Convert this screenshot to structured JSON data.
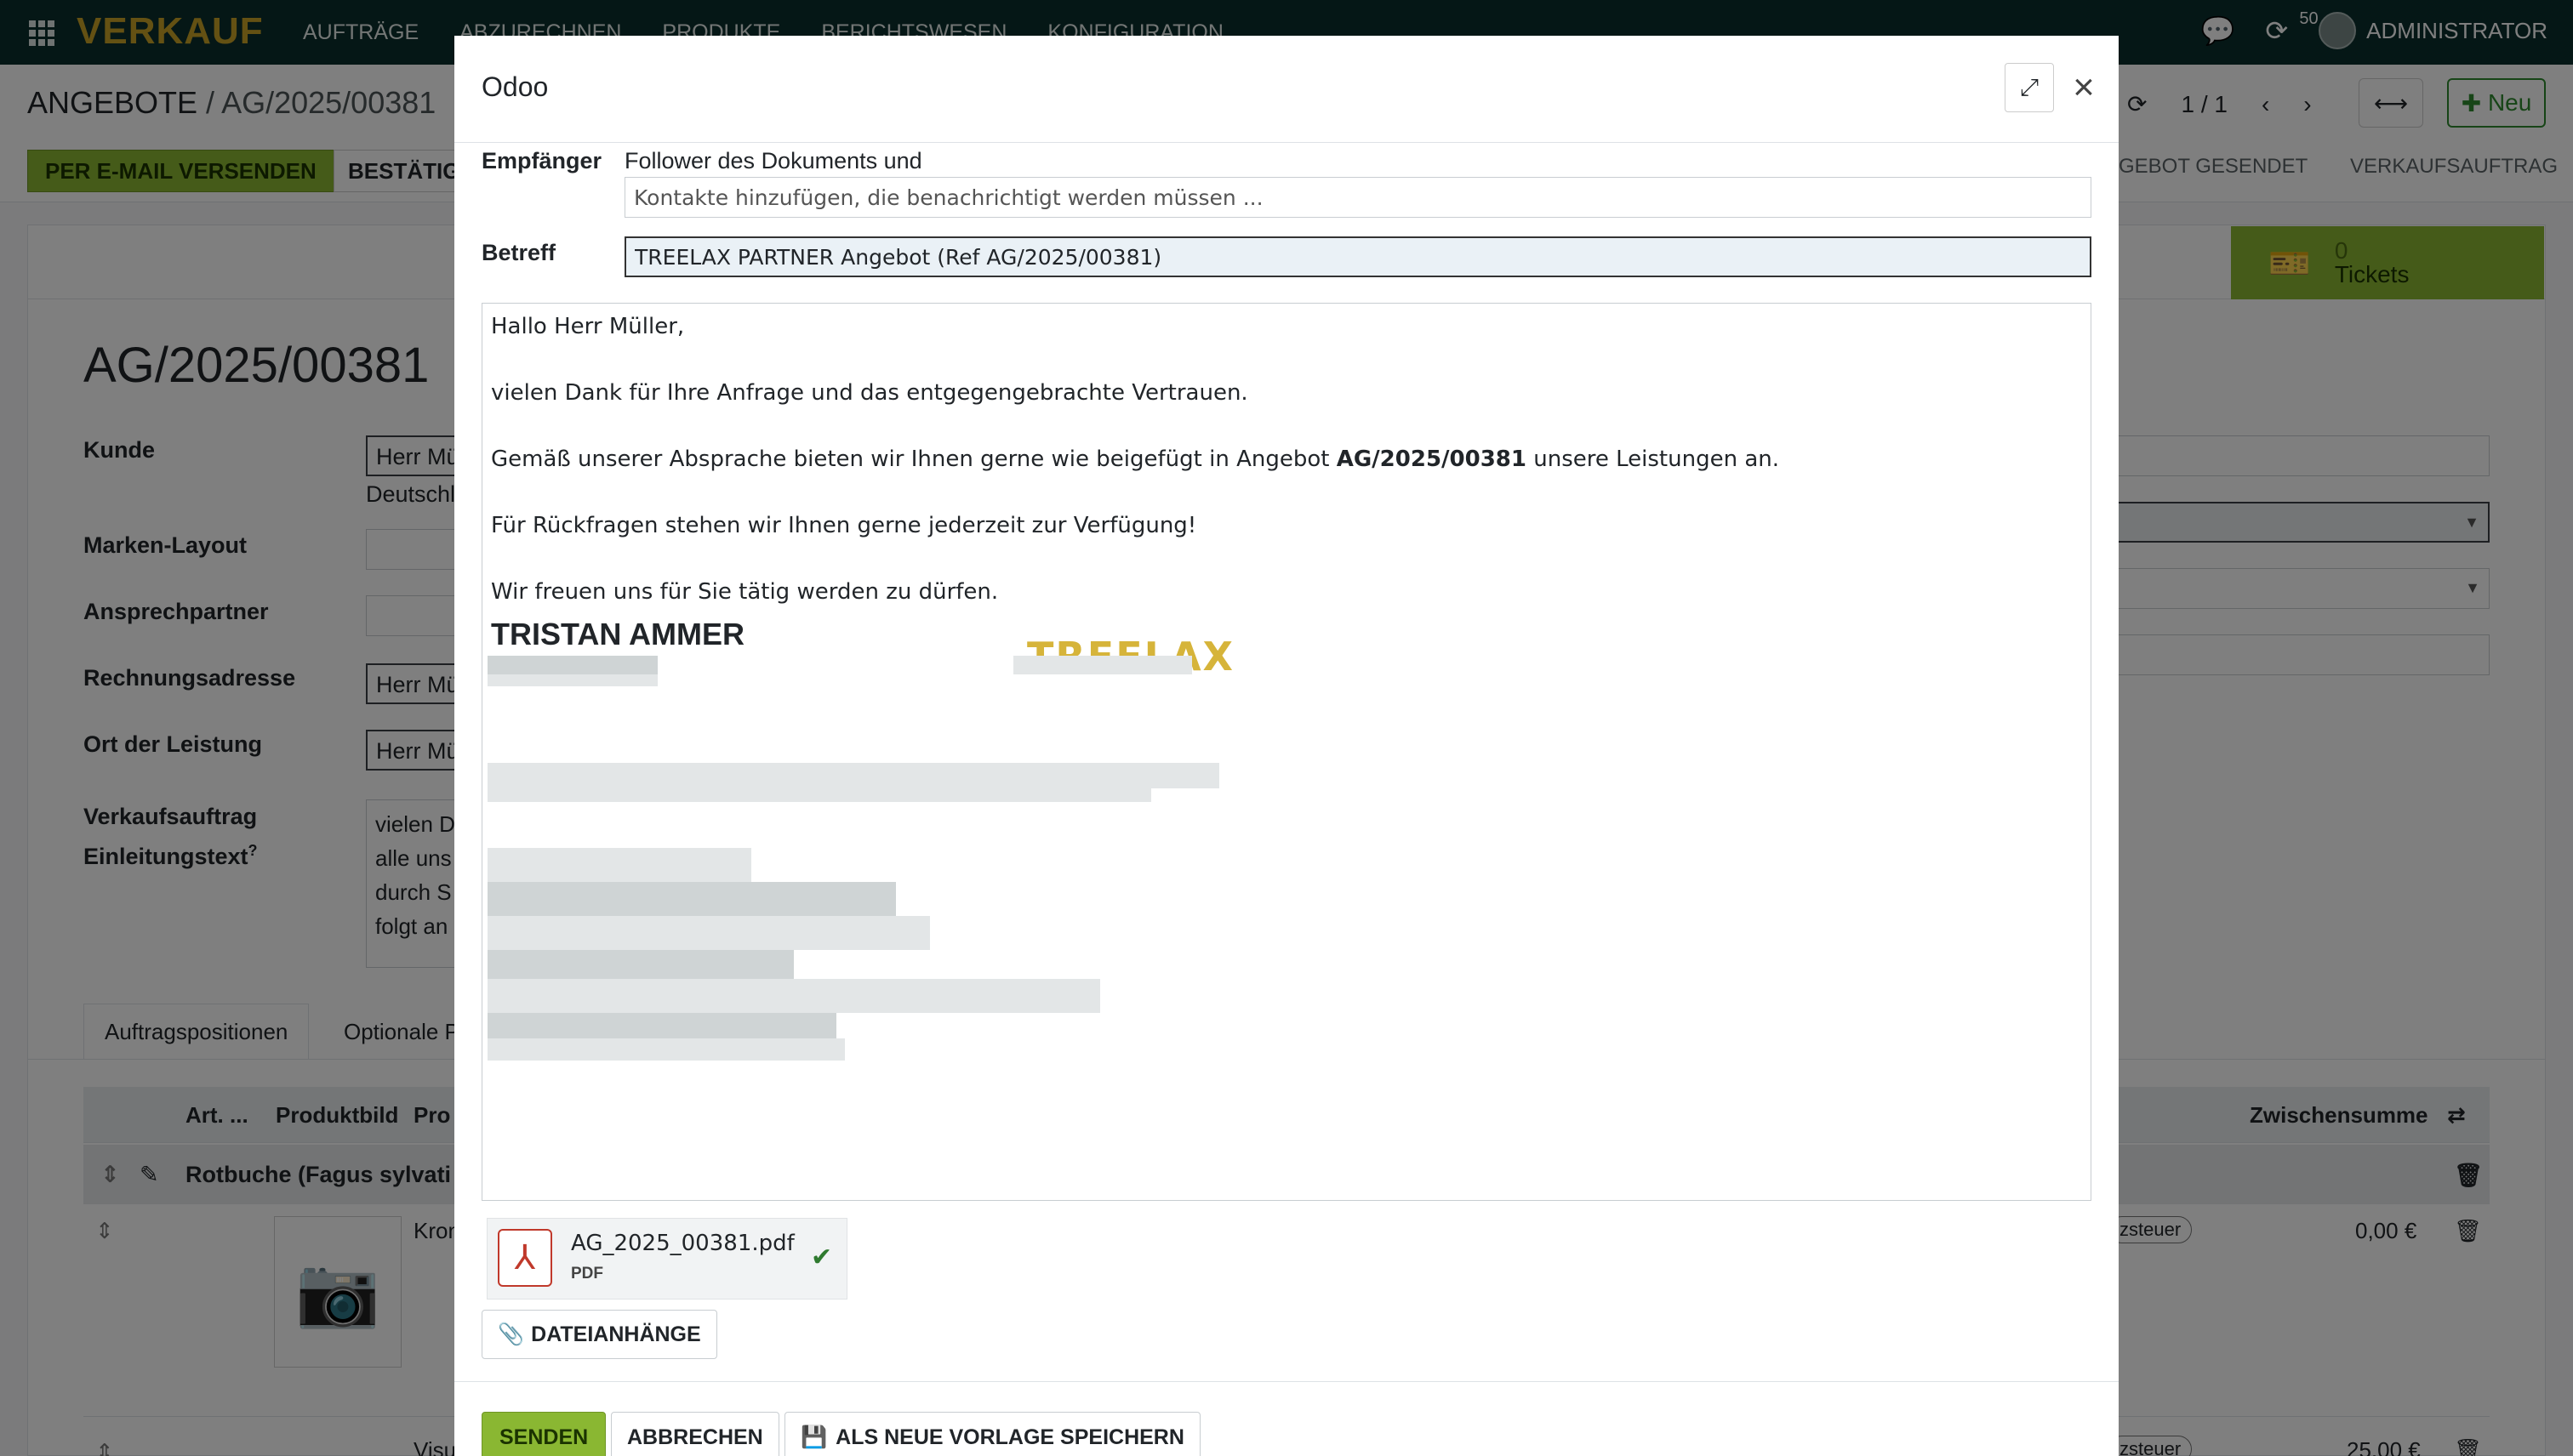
{
  "navbar": {
    "brand": "VERKAUF",
    "menu": [
      "AUFTRÄGE",
      "ABZURECHNEN",
      "PRODUKTE",
      "BERICHTSWESEN",
      "KONFIGURATION"
    ],
    "activity_count": "50",
    "user": "ADMINISTRATOR"
  },
  "control": {
    "breadcrumb_parent": "ANGEBOTE",
    "breadcrumb_sep": " / ",
    "breadcrumb_current": "AG/2025/00381",
    "pager": "1 / 1",
    "new_button": "Neu",
    "email_button": "PER E-MAIL VERSENDEN",
    "confirm_button": "BESTÄTIG",
    "status_sent": "GEBOT GESENDET",
    "status_order": "VERKAUFSAUFTRAG"
  },
  "form": {
    "tickets_count": "0",
    "tickets_label": "Tickets",
    "name": "AG/2025/00381",
    "labels": {
      "customer": "Kunde",
      "brand_layout": "Marken-Layout",
      "contact": "Ansprechpartner",
      "invoice_address": "Rechnungsadresse",
      "service_location": "Ort der Leistung",
      "intro_1": "Verkaufsauftrag",
      "intro_2": "Einleitungstext",
      "intro_help": "?"
    },
    "customer_value": "Herr Mü",
    "customer_sub": "Deutschl",
    "invoice_value": "Herr Mü",
    "service_value": "Herr Mü",
    "intro_lines": [
      "vielen D",
      "alle uns",
      "durch S",
      "folgt an"
    ],
    "tabs": [
      "Auftragspositionen",
      "Optionale P"
    ],
    "columns": {
      "type": "Art. ...",
      "image": "Produktbild",
      "product": "Pro",
      "subtotal": "Zwischensumme"
    },
    "section": "Rotbuche (Fagus sylvati",
    "row1_product": "Kron",
    "row1_tax": "zsteuer",
    "row1_amount": "0,00 €",
    "row2_product": "Visu",
    "row2_tax": "zsteuer",
    "row2_amount": "25,00 €"
  },
  "modal": {
    "title": "Odoo",
    "recipients_label": "Empfänger",
    "recipients_static": "Follower des Dokuments und",
    "recipients_placeholder": "Kontakte hinzufügen, die benachrichtigt werden müssen ...",
    "subject_label": "Betreff",
    "subject_value": "TREELAX PARTNER Angebot (Ref AG/2025/00381)",
    "body": {
      "greeting": "Hallo Herr Müller,",
      "line1": "vielen Dank für Ihre Anfrage und das entgegengebrachte Vertrauen.",
      "line2_pre": "Gemäß unserer Absprache bieten wir Ihnen gerne wie beigefügt in Angebot ",
      "line2_ref": "AG/2025/00381",
      "line2_post": " unsere Leistungen an.",
      "line3": "Für Rückfragen stehen wir Ihnen gerne jederzeit zur Verfügung!",
      "line4": "Wir freuen uns für Sie tätig werden zu dürfen.",
      "signature_name": "TRISTAN AMMER",
      "logo_text": "TREELAX"
    },
    "attachment": {
      "filename": "AG_2025_00381.pdf",
      "type": "PDF"
    },
    "attach_button": "DATEIANHÄNGE",
    "send_button": "SENDEN",
    "cancel_button": "ABBRECHEN",
    "template_button": "ALS NEUE VORLAGE SPEICHERN"
  },
  "colors": {
    "navbar": "#0b2e2c",
    "brand": "#c9a227",
    "primary": "#8ab732",
    "logo": "#d6b43a"
  }
}
